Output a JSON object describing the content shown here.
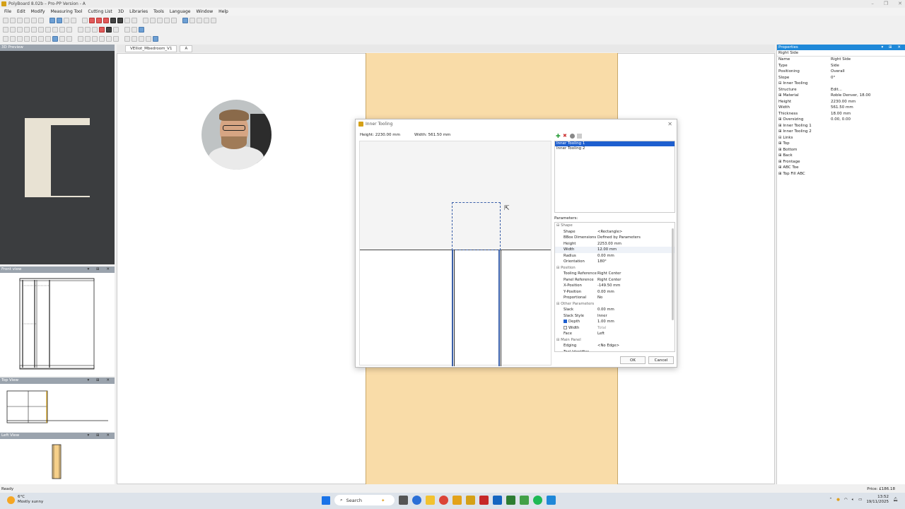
{
  "app": {
    "title": "PolyBoard 8.02b – Pro-PP Version - A",
    "window_controls": [
      "–",
      "❐",
      "✕"
    ]
  },
  "menu": [
    "File",
    "Edit",
    "Modify",
    "Measuring Tool",
    "Cutting List",
    "3D",
    "Libraries",
    "Tools",
    "Language",
    "Window",
    "Help"
  ],
  "panels": {
    "preview": "3D Preview",
    "front": "Front view",
    "top": "Top View",
    "left": "Left View",
    "panel_ctrls": "▾ ⊞ ✕"
  },
  "doc_tabs": [
    "VElliot_Mbedroom_V1",
    "A"
  ],
  "properties": {
    "header": "Properties",
    "selected": "Right Side",
    "rows": [
      {
        "k": "Name",
        "v": "Right Side"
      },
      {
        "k": "Type",
        "v": "Side"
      },
      {
        "k": "Positioning",
        "v": "Overall"
      },
      {
        "k": "Slope",
        "v": "0°"
      },
      {
        "k": "⊟ Inner Tooling",
        "v": ""
      },
      {
        "k": "   Structure",
        "v": "Edit..."
      },
      {
        "k": "   ⊞ Material",
        "v": "Roble Denver, 18.00"
      },
      {
        "k": "   Height",
        "v": "2230.00 mm"
      },
      {
        "k": "   Width",
        "v": "561.50 mm"
      },
      {
        "k": "   Thickness",
        "v": "18.00 mm"
      },
      {
        "k": "   ⊞ Oversizing",
        "v": "0.00, 0.00"
      },
      {
        "k": "   ⊞ Inner Tooling 1",
        "v": ""
      },
      {
        "k": "   ⊞ Inner Tooling 2",
        "v": ""
      },
      {
        "k": "⊟ Links",
        "v": ""
      },
      {
        "k": "   ⊞ Top",
        "v": ""
      },
      {
        "k": "   ⊞ Bottom",
        "v": ""
      },
      {
        "k": "   ⊞ Back",
        "v": ""
      },
      {
        "k": "   ⊞ Frontage",
        "v": ""
      },
      {
        "k": "   ⊞ ABC Toe",
        "v": ""
      },
      {
        "k": "   ⊞ Top Fill ABC",
        "v": ""
      }
    ]
  },
  "dialog": {
    "title": "Inner Tooling",
    "close": "✕",
    "height_label": "Height: 2230.00 mm",
    "width_label": "Width: 561.50 mm",
    "list": [
      "Inner Tooling 1",
      "Inner Tooling 2"
    ],
    "parameters_label": "Parameters:",
    "params": [
      {
        "sect": "⊟ Shape"
      },
      {
        "k": "Shape",
        "v": "<Rectangle>"
      },
      {
        "k": "BBox Dimensions",
        "v": "Defined by Parameters"
      },
      {
        "k": "Height",
        "v": "2253.00 mm"
      },
      {
        "k": "Width",
        "v": "12.00 mm"
      },
      {
        "k": "Radius",
        "v": "0.00 mm"
      },
      {
        "k": "Orientation",
        "v": "180°"
      },
      {
        "sect": "⊟ Position"
      },
      {
        "k": "Tooling Reference",
        "v": "Right Center"
      },
      {
        "k": "Panel Reference",
        "v": "Right Center"
      },
      {
        "k": "X-Position",
        "v": "-149.50 mm"
      },
      {
        "k": "Y-Position",
        "v": "0.00 mm"
      },
      {
        "k": "Proportional",
        "v": "No"
      },
      {
        "sect": "⊟ Other Parameters"
      },
      {
        "k": "Slack",
        "v": "0.00 mm"
      },
      {
        "k": "Slack Style",
        "v": "Inner"
      },
      {
        "k": "Depth",
        "v": "1.00 mm",
        "cb": true
      },
      {
        "k": "Width",
        "v": "Total",
        "cb": false
      },
      {
        "k": "Face",
        "v": "Left"
      },
      {
        "sect": "⊟ Main Panel"
      },
      {
        "k": "Edging",
        "v": "<No Edge>"
      },
      {
        "k": "Tool Identifier",
        "v": ""
      }
    ],
    "ok": "OK",
    "cancel": "Cancel"
  },
  "status": {
    "left": "Ready",
    "price": "Price: £186.18"
  },
  "taskbar": {
    "temp": "6°C",
    "weather": "Mostly sunny",
    "search": "Search",
    "time": "13:52",
    "date": "19/11/2025"
  }
}
